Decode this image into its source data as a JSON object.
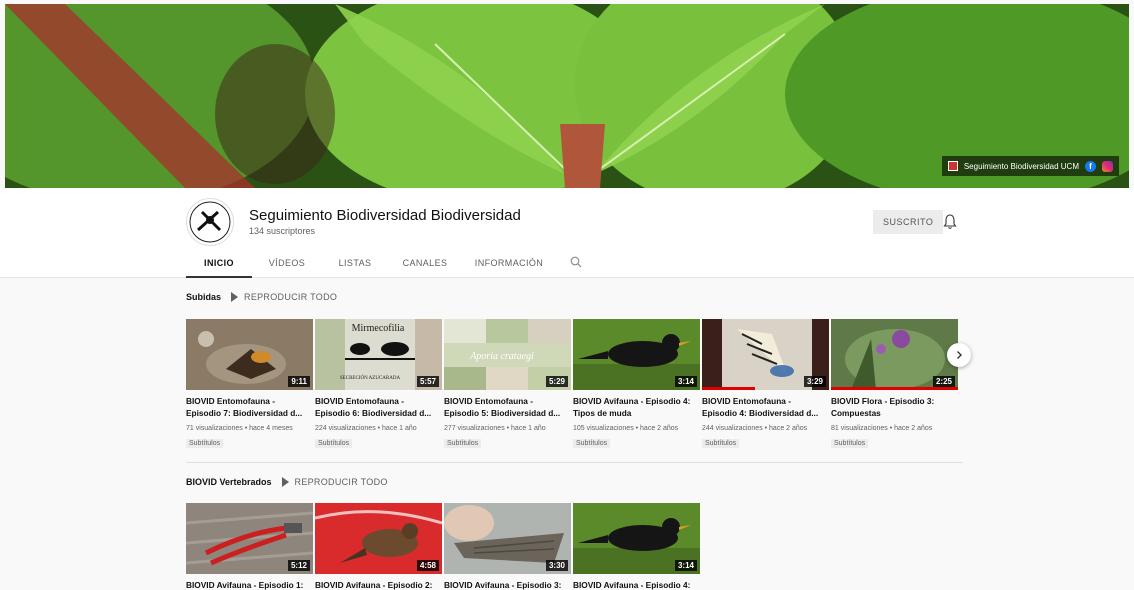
{
  "banner": {
    "channel_link": "Seguimiento Biodiversidad UCM",
    "fb_glyph": "f"
  },
  "channel": {
    "title": "Seguimiento Biodiversidad Biodiversidad",
    "subscribers": "134 suscriptores",
    "subscribe_label": "SUSCRITO"
  },
  "tabs": [
    "INICIO",
    "VÍDEOS",
    "LISTAS",
    "CANALES",
    "INFORMACIÓN"
  ],
  "shelves": [
    {
      "title": "Subidas",
      "play_all": "REPRODUCIR TODO",
      "videos": [
        {
          "title": "BIOVID Entomofauna - Episodio 7: Biodiversidad d...",
          "duration": "9:11",
          "meta": "71 visualizaciones • hace 4 meses",
          "badge": "Subtítulos",
          "watched": 0
        },
        {
          "title": "BIOVID Entomofauna - Episodio 6: Biodiversidad d...",
          "duration": "5:57",
          "meta": "224 visualizaciones • hace 1 año",
          "badge": "Subtítulos",
          "watched": 0,
          "overlay_title": "Mirmecofilia",
          "overlay_sub": "SECRECIÓN AZUCARADA"
        },
        {
          "title": "BIOVID Entomofauna - Episodio 5: Biodiversidad d...",
          "duration": "5:29",
          "meta": "277 visualizaciones • hace 1 año",
          "badge": "Subtítulos",
          "watched": 0,
          "overlay_title": "Aporia crataegi"
        },
        {
          "title": "BIOVID Avifauna - Episodio 4: Tipos de muda",
          "duration": "3:14",
          "meta": "105 visualizaciones • hace 2 años",
          "badge": "Subtítulos",
          "watched": 0
        },
        {
          "title": "BIOVID Entomofauna - Episodio 4: Biodiversidad d...",
          "duration": "3:29",
          "meta": "244 visualizaciones • hace 2 años",
          "badge": "Subtítulos",
          "watched": 0.42
        },
        {
          "title": "BIOVID Flora - Episodio 3: Compuestas",
          "duration": "2:25",
          "meta": "81 visualizaciones • hace 2 años",
          "badge": "Subtítulos",
          "watched": 1.0
        }
      ]
    },
    {
      "title": "BIOVID Vertebrados",
      "play_all": "REPRODUCIR TODO",
      "videos": [
        {
          "title": "BIOVID Avifauna - Episodio 1:",
          "duration": "5:12",
          "watched": 0
        },
        {
          "title": "BIOVID Avifauna - Episodio 2:",
          "duration": "4:58",
          "watched": 0
        },
        {
          "title": "BIOVID Avifauna - Episodio 3:",
          "duration": "3:30",
          "watched": 0
        },
        {
          "title": "BIOVID Avifauna - Episodio 4:",
          "duration": "3:14",
          "watched": 0
        }
      ]
    }
  ],
  "colors": {
    "progress": "#e00000",
    "fb": "#1877f2"
  },
  "icons": {
    "bell": "bell-icon",
    "search": "search-icon",
    "next": "chevron-right-icon",
    "play": "play-icon"
  }
}
